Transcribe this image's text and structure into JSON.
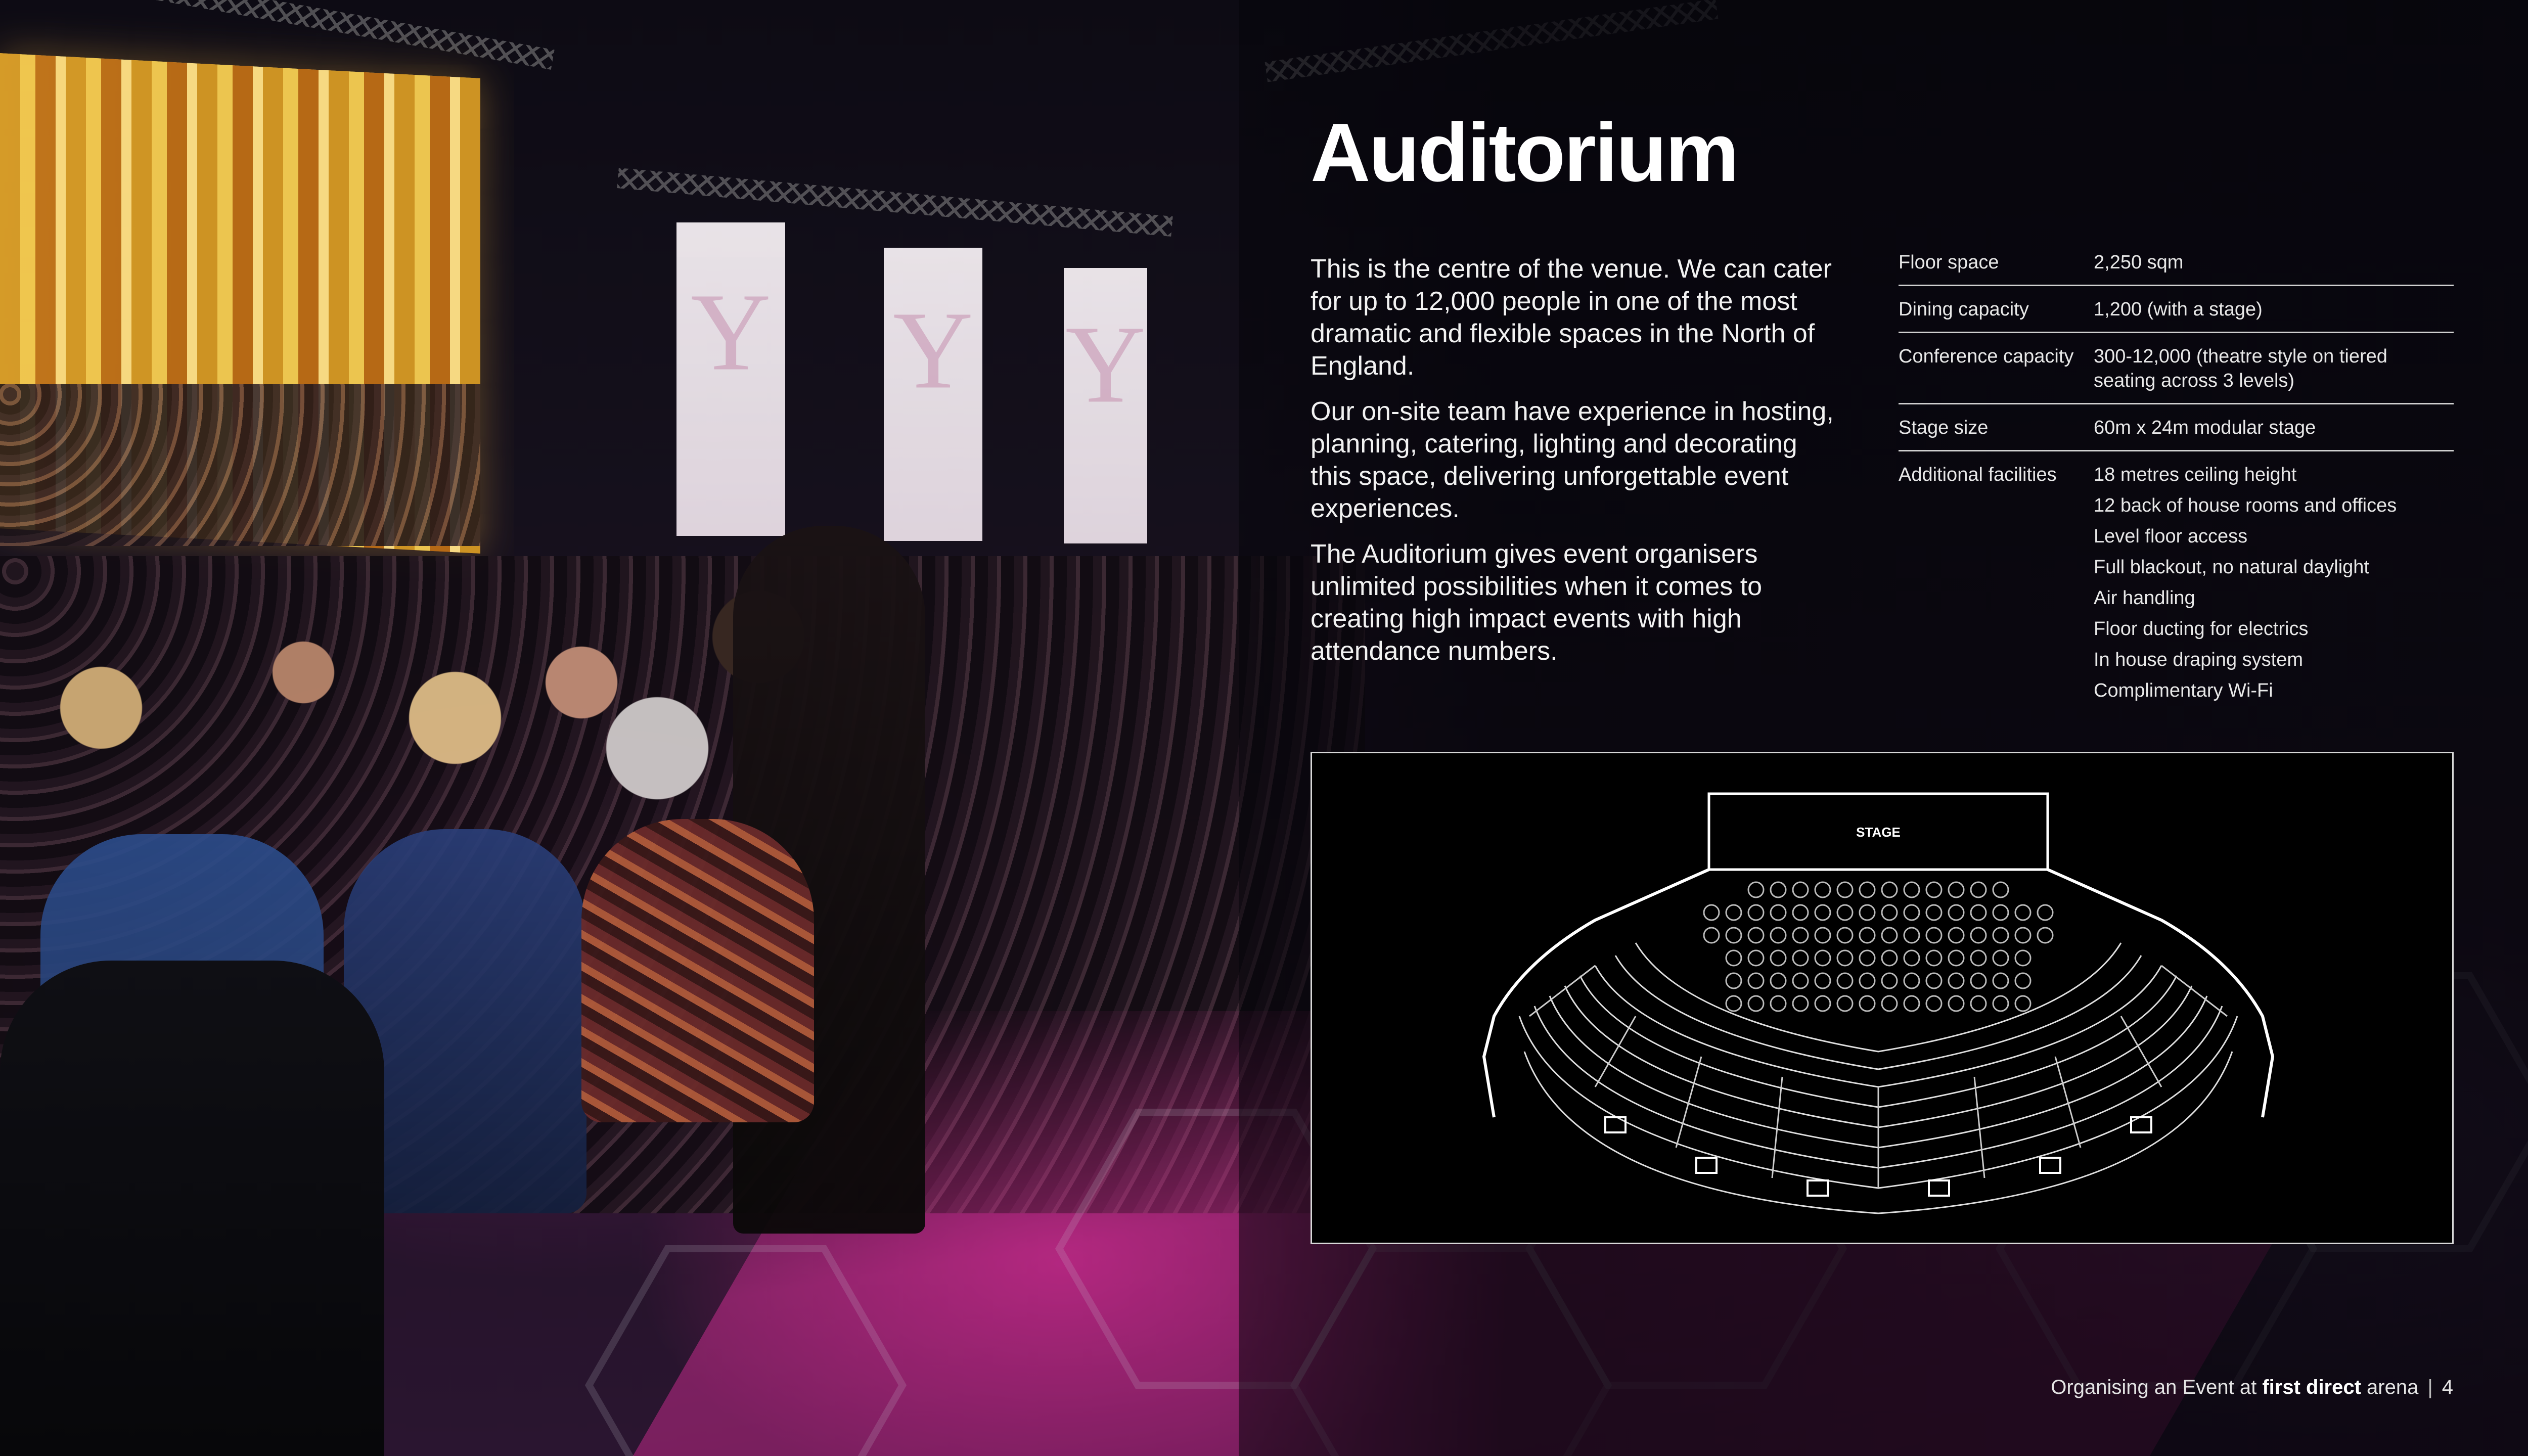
{
  "page": {
    "title": "Auditorium",
    "intro_paragraphs": [
      "This is the centre of the venue. We can cater for up to 12,000 people in one of the most dramatic and flexible spaces in the North of England.",
      "Our on-site team have experience in hosting, planning, catering, lighting and decorating this space, delivering unforgettable event experiences.",
      "The Auditorium gives event organisers unlimited possibilities when it comes to creating high impact events with high attendance numbers."
    ]
  },
  "specs": [
    {
      "label": "Floor space",
      "value": "2,250 sqm"
    },
    {
      "label": "Dining capacity",
      "value": "1,200 (with a stage)"
    },
    {
      "label": "Conference capacity",
      "value": "300-12,000 (theatre style on tiered seating across 3 levels)"
    },
    {
      "label": "Stage size",
      "value": "60m x 24m modular stage"
    }
  ],
  "additional_facilities": {
    "label": "Additional facilities",
    "items": [
      "18 metres ceiling height",
      "12 back of house rooms and offices",
      "Level floor access",
      "Full blackout, no natural daylight",
      "Air handling",
      "Floor ducting for electrics",
      "In house draping system",
      "Complimentary Wi-Fi"
    ]
  },
  "floor_plan": {
    "stage_label": "STAGE"
  },
  "footer": {
    "prefix": "Organising an Event at ",
    "brand": "first direct",
    "suffix": " arena",
    "page_number": "4"
  }
}
